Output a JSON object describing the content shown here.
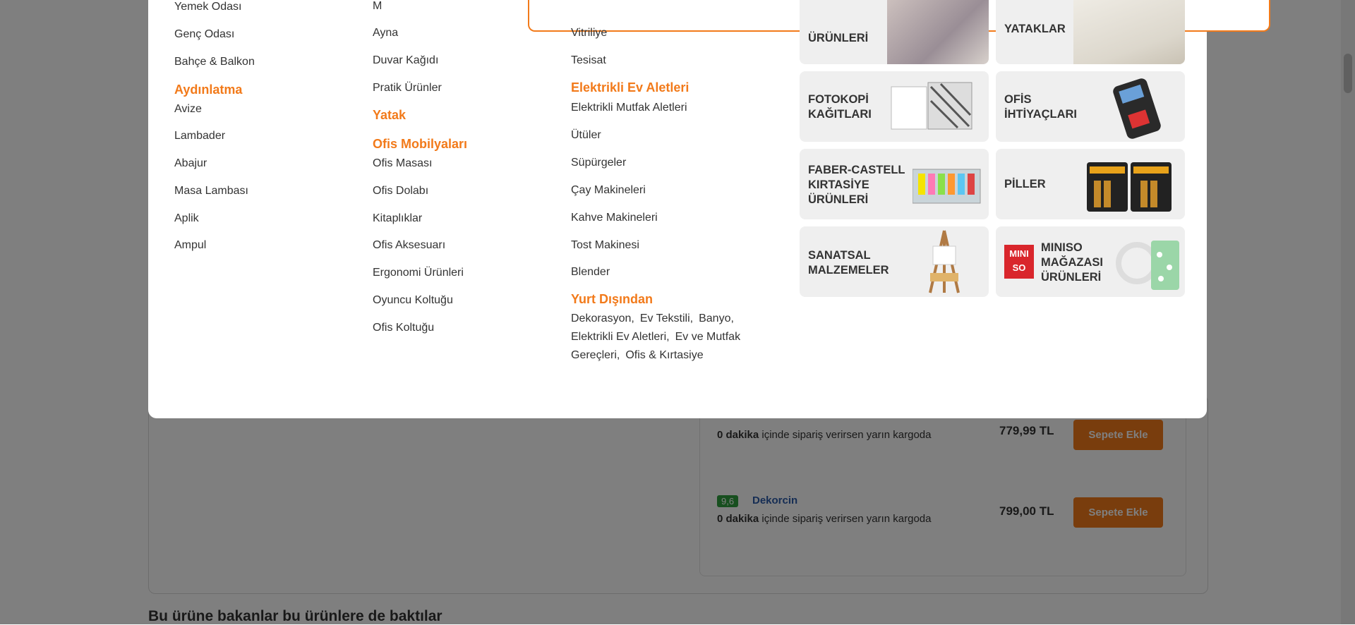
{
  "background": {
    "offers": [
      {
        "rating": "",
        "seller": "",
        "shipping_bold": "0 dakika",
        "shipping_rest": " içinde sipariş verirsen yarın kargoda",
        "price": "779,99 TL",
        "button": "Sepete Ekle"
      },
      {
        "rating": "9,6",
        "seller": "Dekorcin",
        "shipping_bold": "0 dakika",
        "shipping_rest": " içinde sipariş verirsen yarın kargoda",
        "price": "799,00 TL",
        "button": "Sepete Ekle"
      }
    ],
    "related_title": "Bu ürüne bakanlar bu ürünlere de baktılar"
  },
  "menu": {
    "col1": {
      "items_top": [
        "Yemek Odası",
        "Genç Odası",
        "Bahçe & Balkon"
      ],
      "heading_lighting": "Aydınlatma",
      "lighting_items": [
        "Avize",
        "Lambader",
        "Abajur",
        "Masa Lambası",
        "Aplik",
        "Ampul"
      ]
    },
    "col2": {
      "items_top": [
        "M",
        "Ayna",
        "Duvar Kağıdı",
        "Pratik Ürünler"
      ],
      "heading_bed": "Yatak",
      "heading_office": "Ofis Mobilyaları",
      "office_items": [
        "Ofis Masası",
        "Ofis Dolabı",
        "Kitaplıklar",
        "Ofis Aksesuarı",
        "Ergonomi Ürünleri",
        "Oyuncu Koltuğu",
        "Ofis Koltuğu"
      ]
    },
    "col3": {
      "items_top": [
        "Vitriliye",
        "Tesisat"
      ],
      "heading_appliances": "Elektrikli Ev Aletleri",
      "appliance_items": [
        "Elektrikli Mutfak Aletleri",
        "Ütüler",
        "Süpürgeler",
        "Çay Makineleri",
        "Kahve Makineleri",
        "Tost Makinesi",
        "Blender"
      ],
      "heading_abroad": "Yurt Dışından",
      "abroad_links": [
        "Dekorasyon,",
        "Ev Tekstili,",
        "Banyo,",
        "Elektrikli Ev Aletleri,",
        "Ev ve Mutfak Gereçleri,",
        "Ofis & Kırtasiye"
      ]
    },
    "tiles": [
      {
        "label_lines": [
          "ÜRÜNLERİ"
        ],
        "icon": "textile-image"
      },
      {
        "label_lines": [
          "YATAKLAR"
        ],
        "icon": "mattress-image"
      },
      {
        "label_lines": [
          "FOTOKOPİ",
          "KAĞITLARI"
        ],
        "icon": "paper-box-image"
      },
      {
        "label_lines": [
          "OFİS",
          "İHTİYAÇLARI"
        ],
        "icon": "pos-terminal-image"
      },
      {
        "label_lines": [
          "FABER-CASTELL",
          "KIRTASİYE",
          "ÜRÜNLERİ"
        ],
        "icon": "highlighters-image"
      },
      {
        "label_lines": [
          "PİLLER"
        ],
        "icon": "batteries-image"
      },
      {
        "label_lines": [
          "SANATSAL",
          "MALZEMELER"
        ],
        "icon": "easel-image"
      },
      {
        "label_lines": [
          "MINISO",
          "MAĞAZASI",
          "ÜRÜNLERİ"
        ],
        "icon": "miniso-image",
        "logo_text": "MINI SO"
      }
    ]
  },
  "colors": {
    "accent": "#f27a1a",
    "overlay": "rgba(0,0,0,0.5)",
    "rating": "#2e9e3e",
    "seller_link": "#2b5aa8"
  }
}
